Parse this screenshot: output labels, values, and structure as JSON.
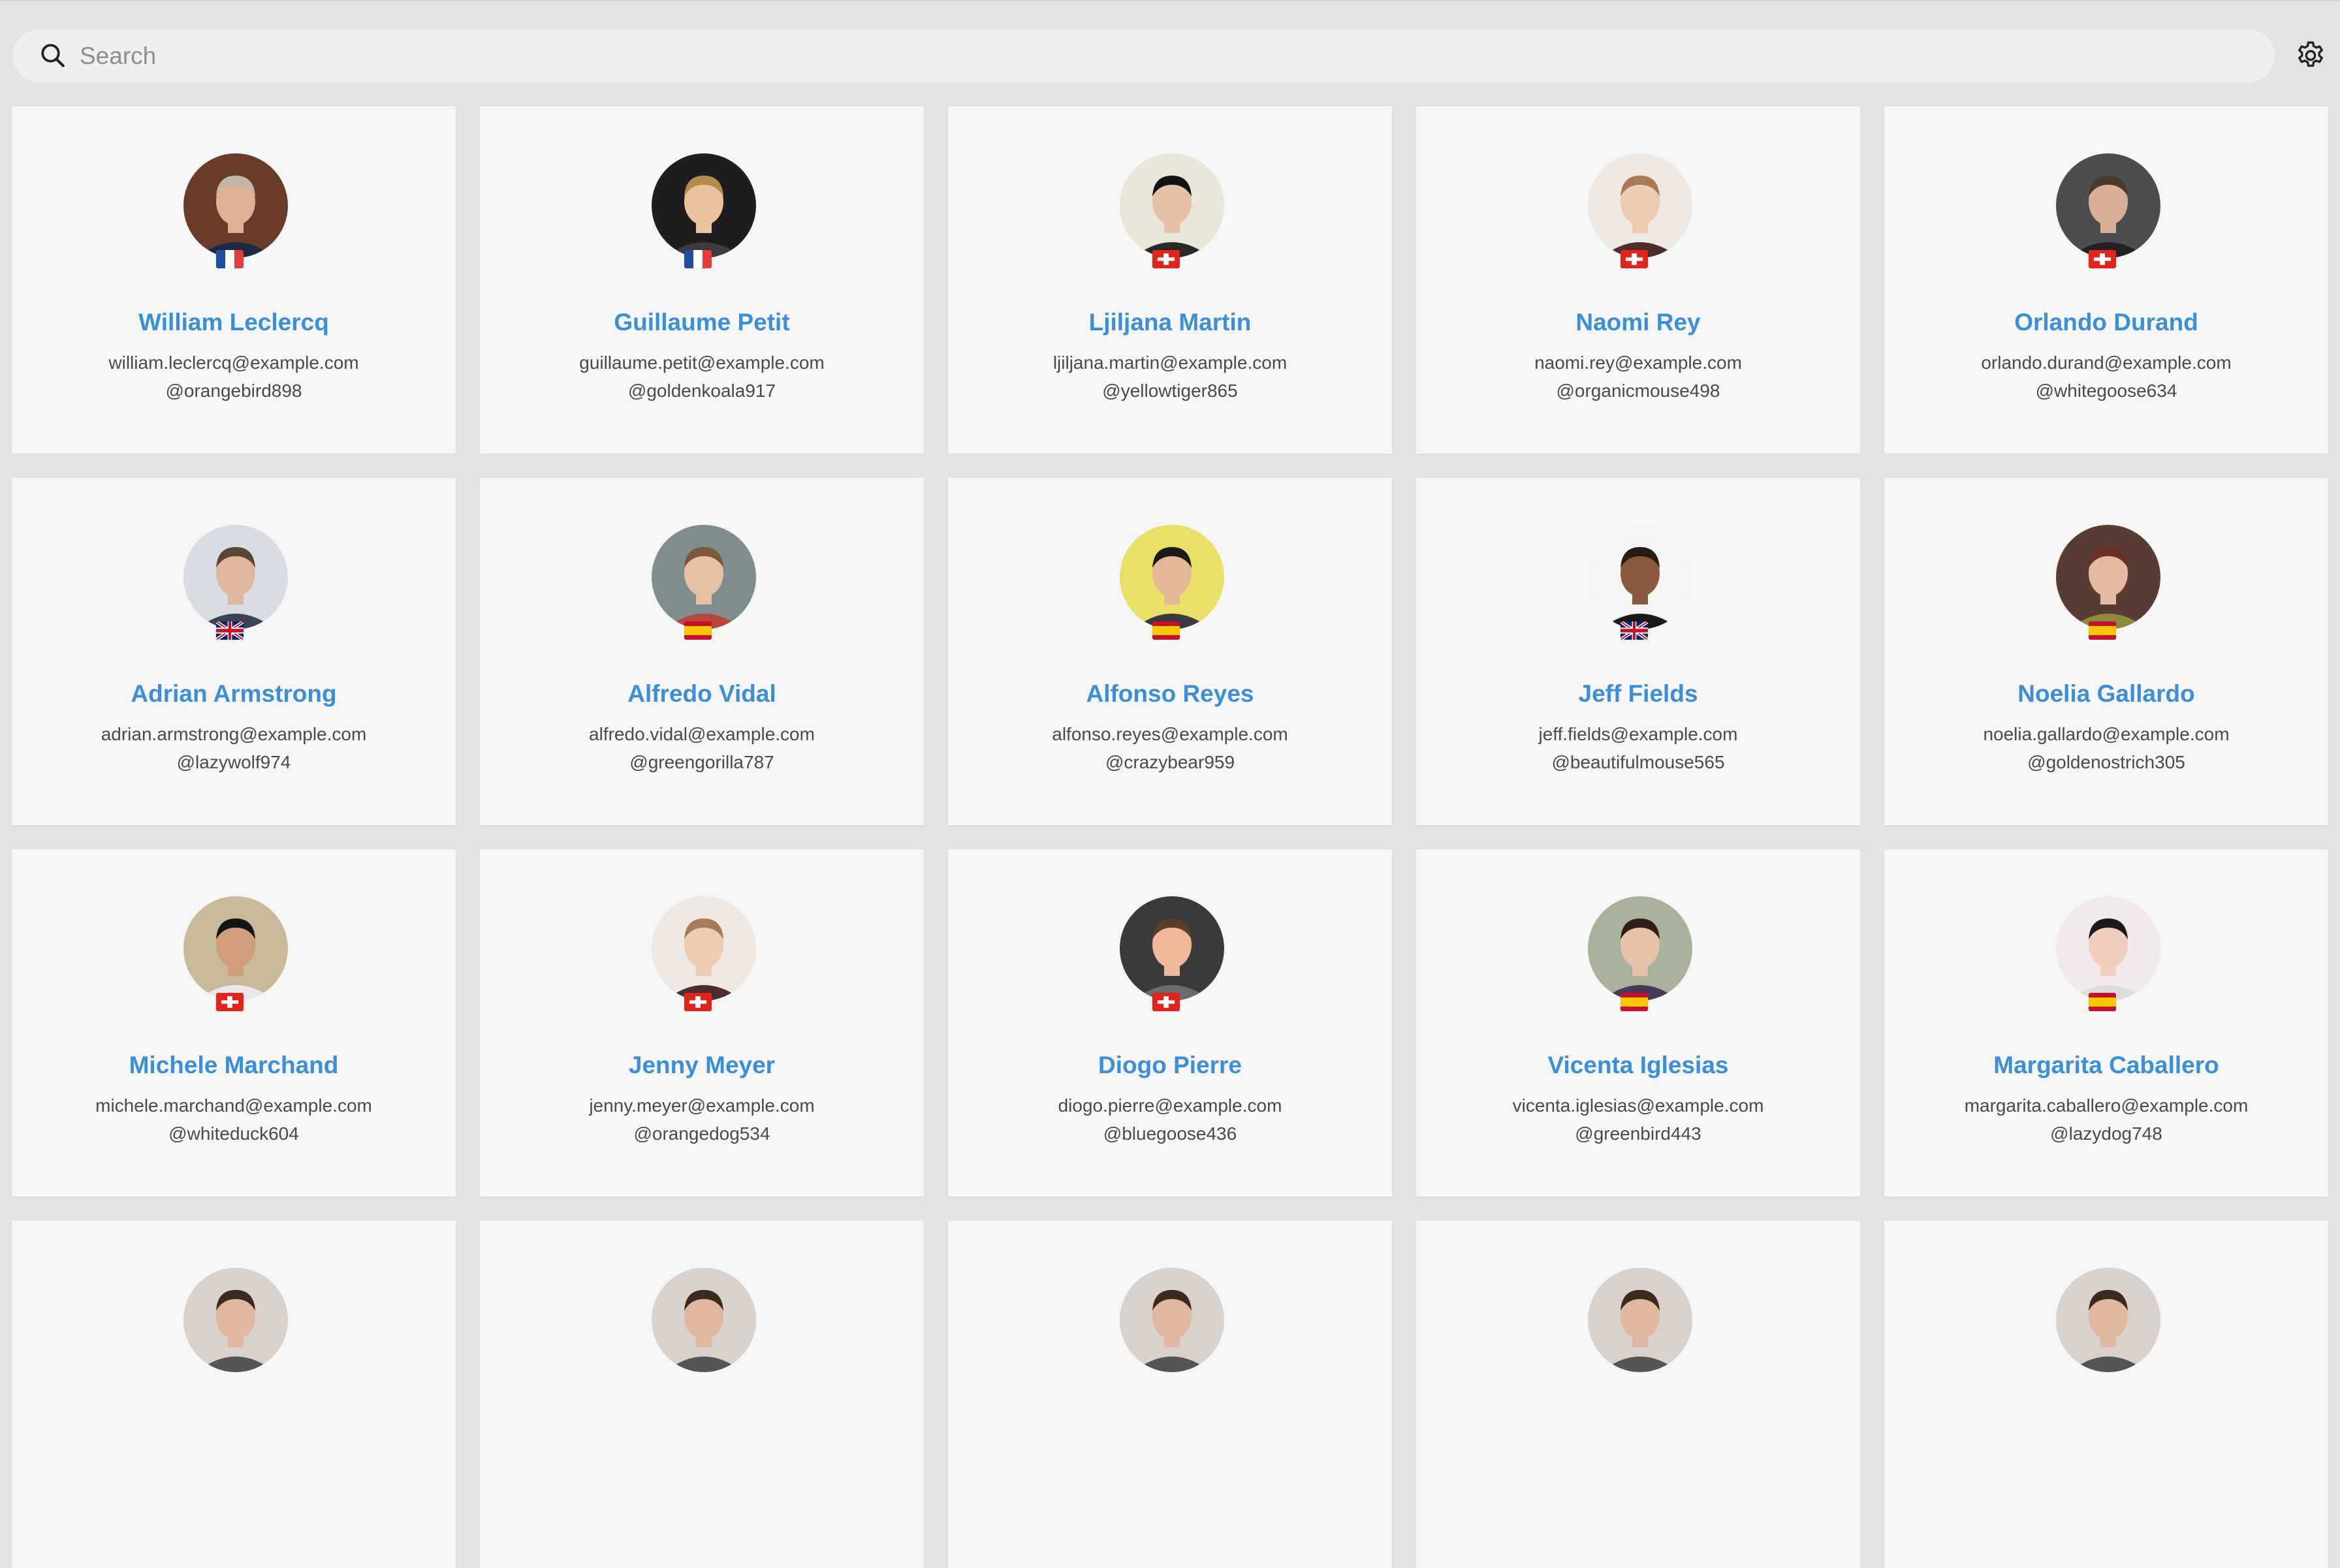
{
  "search": {
    "placeholder": "Search",
    "value": ""
  },
  "settings_icon": "gear-icon",
  "colors": {
    "name_link": "#3a8fd8",
    "card_bg": "#f6f6f6",
    "page_bg": "#e3e3e3"
  },
  "users": [
    {
      "name": "William Leclercq",
      "email": "william.leclercq@example.com",
      "handle": "@orangebird898",
      "flag": "fr",
      "avatar": {
        "bg": "#6b3b2a",
        "skin": "#e0b095",
        "hair": "#bfb7a8",
        "shirt": "#1d2a44"
      }
    },
    {
      "name": "Guillaume Petit",
      "email": "guillaume.petit@example.com",
      "handle": "@goldenkoala917",
      "flag": "fr",
      "avatar": {
        "bg": "#1e1e1e",
        "skin": "#edc39f",
        "hair": "#b58a4e",
        "shirt": "#3c3c3c"
      }
    },
    {
      "name": "Ljiljana Martin",
      "email": "ljiljana.martin@example.com",
      "handle": "@yellowtiger865",
      "flag": "ch",
      "avatar": {
        "bg": "#e9e6d8",
        "skin": "#e6c0a6",
        "hair": "#111111",
        "shirt": "#2a2a2a"
      }
    },
    {
      "name": "Naomi Rey",
      "email": "naomi.rey@example.com",
      "handle": "@organicmouse498",
      "flag": "ch",
      "avatar": {
        "bg": "#efe8e2",
        "skin": "#edcbb2",
        "hair": "#a87a56",
        "shirt": "#4b2e2e"
      }
    },
    {
      "name": "Orlando Durand",
      "email": "orlando.durand@example.com",
      "handle": "@whitegoose634",
      "flag": "ch",
      "avatar": {
        "bg": "#4b4d4e",
        "skin": "#d9b095",
        "hair": "#4a3a2e",
        "shirt": "#222222"
      }
    },
    {
      "name": "Adrian Armstrong",
      "email": "adrian.armstrong@example.com",
      "handle": "@lazywolf974",
      "flag": "gb",
      "avatar": {
        "bg": "#d8dde3",
        "skin": "#e0b79e",
        "hair": "#5a4636",
        "shirt": "#3a4452"
      }
    },
    {
      "name": "Alfredo Vidal",
      "email": "alfredo.vidal@example.com",
      "handle": "@greengorilla787",
      "flag": "es",
      "avatar": {
        "bg": "#7e8e8e",
        "skin": "#e8c0a3",
        "hair": "#7a5a3a",
        "shirt": "#b8463c"
      }
    },
    {
      "name": "Alfonso Reyes",
      "email": "alfonso.reyes@example.com",
      "handle": "@crazybear959",
      "flag": "es",
      "avatar": {
        "bg": "#e9e06a",
        "skin": "#e3b796",
        "hair": "#1e1a18",
        "shirt": "#3b3b3b"
      }
    },
    {
      "name": "Jeff Fields",
      "email": "jeff.fields@example.com",
      "handle": "@beautifulmouse565",
      "flag": "gb",
      "avatar": {
        "bg": "#f4f4f4",
        "skin": "#8b5a3e",
        "hair": "#2a1b14",
        "shirt": "#1a1a1a"
      }
    },
    {
      "name": "Noelia Gallardo",
      "email": "noelia.gallardo@example.com",
      "handle": "@goldenostrich305",
      "flag": "es",
      "avatar": {
        "bg": "#5a3d32",
        "skin": "#e6b9a3",
        "hair": "#6e2f2a",
        "shirt": "#8e8b3c"
      }
    },
    {
      "name": "Michele Marchand",
      "email": "michele.marchand@example.com",
      "handle": "@whiteduck604",
      "flag": "ch",
      "avatar": {
        "bg": "#c8b99a",
        "skin": "#cf9e79",
        "hair": "#151515",
        "shirt": "#e8e8e8"
      }
    },
    {
      "name": "Jenny Meyer",
      "email": "jenny.meyer@example.com",
      "handle": "@orangedog534",
      "flag": "ch",
      "avatar": {
        "bg": "#efe8e2",
        "skin": "#edcbb2",
        "hair": "#a87a56",
        "shirt": "#4b2e2e"
      }
    },
    {
      "name": "Diogo Pierre",
      "email": "diogo.pierre@example.com",
      "handle": "@bluegoose436",
      "flag": "ch",
      "avatar": {
        "bg": "#3a3a3a",
        "skin": "#efb99a",
        "hair": "#5a3e2a",
        "shirt": "#6b6b6b"
      }
    },
    {
      "name": "Vicenta Iglesias",
      "email": "vicenta.iglesias@example.com",
      "handle": "@greenbird443",
      "flag": "es",
      "avatar": {
        "bg": "#a8b29a",
        "skin": "#e7c2a8",
        "hair": "#2e2018",
        "shirt": "#4a3a5a"
      }
    },
    {
      "name": "Margarita Caballero",
      "email": "margarita.caballero@example.com",
      "handle": "@lazydog748",
      "flag": "es",
      "avatar": {
        "bg": "#f2eaea",
        "skin": "#f0cdbd",
        "hair": "#1b1b1b",
        "shirt": "#dcdcdc"
      }
    },
    {
      "name": "",
      "email": "",
      "handle": "",
      "flag": "",
      "avatar": {
        "bg": "#d9d2cc",
        "skin": "#e0b79e",
        "hair": "#3a2a20",
        "shirt": "#555555"
      }
    },
    {
      "name": "",
      "email": "",
      "handle": "",
      "flag": "",
      "avatar": {
        "bg": "#d9d2cc",
        "skin": "#e0b79e",
        "hair": "#3a2a20",
        "shirt": "#555555"
      }
    },
    {
      "name": "",
      "email": "",
      "handle": "",
      "flag": "",
      "avatar": {
        "bg": "#d9d2cc",
        "skin": "#e0b79e",
        "hair": "#3a2a20",
        "shirt": "#555555"
      }
    },
    {
      "name": "",
      "email": "",
      "handle": "",
      "flag": "",
      "avatar": {
        "bg": "#d9d2cc",
        "skin": "#e0b79e",
        "hair": "#3a2a20",
        "shirt": "#555555"
      }
    },
    {
      "name": "",
      "email": "",
      "handle": "",
      "flag": "",
      "avatar": {
        "bg": "#d9d2cc",
        "skin": "#e0b79e",
        "hair": "#3a2a20",
        "shirt": "#555555"
      }
    }
  ]
}
